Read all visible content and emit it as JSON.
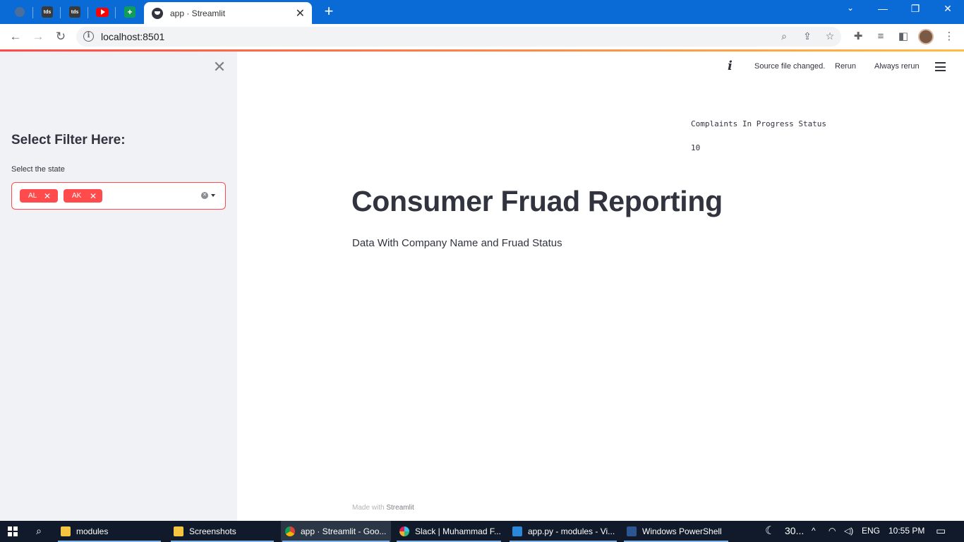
{
  "browser": {
    "active_tab_title": "app · Streamlit",
    "new_tab_symbol": "+",
    "url": "localhost:8501",
    "pinned_tabs": [
      {
        "icon": "gray-globe-icon"
      },
      {
        "icon": "tds-icon",
        "text": "tds"
      },
      {
        "icon": "tds-icon",
        "text": "tds"
      },
      {
        "icon": "youtube-icon"
      },
      {
        "icon": "green-plus-icon",
        "text": "+"
      }
    ]
  },
  "sidebar": {
    "header": "Select Filter Here:",
    "filter_label": "Select the state",
    "selected_states": [
      "AL",
      "AK"
    ]
  },
  "status_bar": {
    "message": "Source file changed.",
    "rerun_label": "Rerun",
    "always_rerun_label": "Always rerun"
  },
  "main": {
    "kpi_label": "Complaints In Progress Status",
    "kpi_value": "10",
    "title": "Consumer Fruad Reporting",
    "subtitle": "Data With Company Name and Fruad Status"
  },
  "footer": {
    "made_with": "Made with",
    "brand": "Streamlit"
  },
  "taskbar": {
    "apps": [
      {
        "label": "modules",
        "icon": "folder-icon"
      },
      {
        "label": "Screenshots",
        "icon": "folder-icon"
      },
      {
        "label": "app · Streamlit - Goo...",
        "icon": "chrome-icon"
      },
      {
        "label": "Slack | Muhammad F...",
        "icon": "slack-icon"
      },
      {
        "label": "app.py - modules - Vi...",
        "icon": "vscode-icon"
      },
      {
        "label": "Windows PowerShell",
        "icon": "powershell-icon"
      }
    ],
    "weather": "30...",
    "language": "ENG",
    "time": "10:55 PM"
  },
  "colors": {
    "accent": "#ff4b4b",
    "browser_frame": "#0a6ad6",
    "sidebar_bg": "#f0f2f6",
    "text": "#31333f"
  }
}
